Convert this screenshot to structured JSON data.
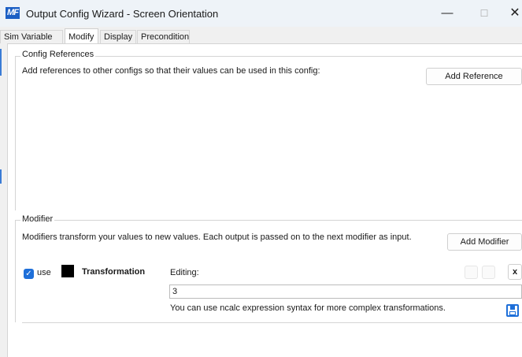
{
  "window": {
    "icon_text": "MF",
    "title": "Output Config Wizard - Screen Orientation",
    "minimize": "—",
    "maximize": "☐",
    "close": "✕"
  },
  "tabs": [
    {
      "label": "Sim Variable",
      "active": false
    },
    {
      "label": "Modify",
      "active": true
    },
    {
      "label": "Display",
      "active": false
    },
    {
      "label": "Precondition",
      "active": false
    }
  ],
  "config_references": {
    "group_label": "Config References",
    "description": "Add references to other configs so that their values can be used in this config:",
    "add_button": "Add Reference"
  },
  "modifier": {
    "group_label": "Modifier",
    "description": "Modifiers transform your values to new values. Each output is passed on to the next modifier as input.",
    "add_button": "Add Modifier",
    "item": {
      "use_checked": true,
      "use_label": "use",
      "color": "#000000",
      "name": "Transformation",
      "editing_label": "Editing:",
      "expression": "3",
      "hint": "You can use ncalc expression syntax for more complex transformations.",
      "remove_label": "x"
    }
  }
}
